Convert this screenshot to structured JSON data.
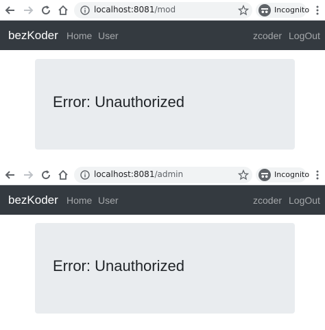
{
  "screens": [
    {
      "browser": {
        "url_host": "localhost:8081",
        "url_path": "/mod",
        "incognito_label": "Incognito"
      },
      "navbar": {
        "brand": "bezKoder",
        "links_left": [
          "Home",
          "User"
        ],
        "links_right": [
          "zcoder",
          "LogOut"
        ]
      },
      "content": {
        "heading": "Error: Unauthorized"
      }
    },
    {
      "browser": {
        "url_host": "localhost:8081",
        "url_path": "/admin",
        "incognito_label": "Incognito"
      },
      "navbar": {
        "brand": "bezKoder",
        "links_left": [
          "Home",
          "User"
        ],
        "links_right": [
          "zcoder",
          "LogOut"
        ]
      },
      "content": {
        "heading": "Error: Unauthorized"
      }
    }
  ],
  "colors": {
    "navbar_bg": "#343a40",
    "card_bg": "#e9ecef",
    "brand_text": "#ffffff",
    "nav_link_text": "rgba(255,255,255,0.55)"
  },
  "icons": [
    "back-arrow-icon",
    "forward-arrow-icon",
    "reload-icon",
    "home-icon",
    "info-icon",
    "star-icon",
    "incognito-icon",
    "more-vert-icon"
  ]
}
